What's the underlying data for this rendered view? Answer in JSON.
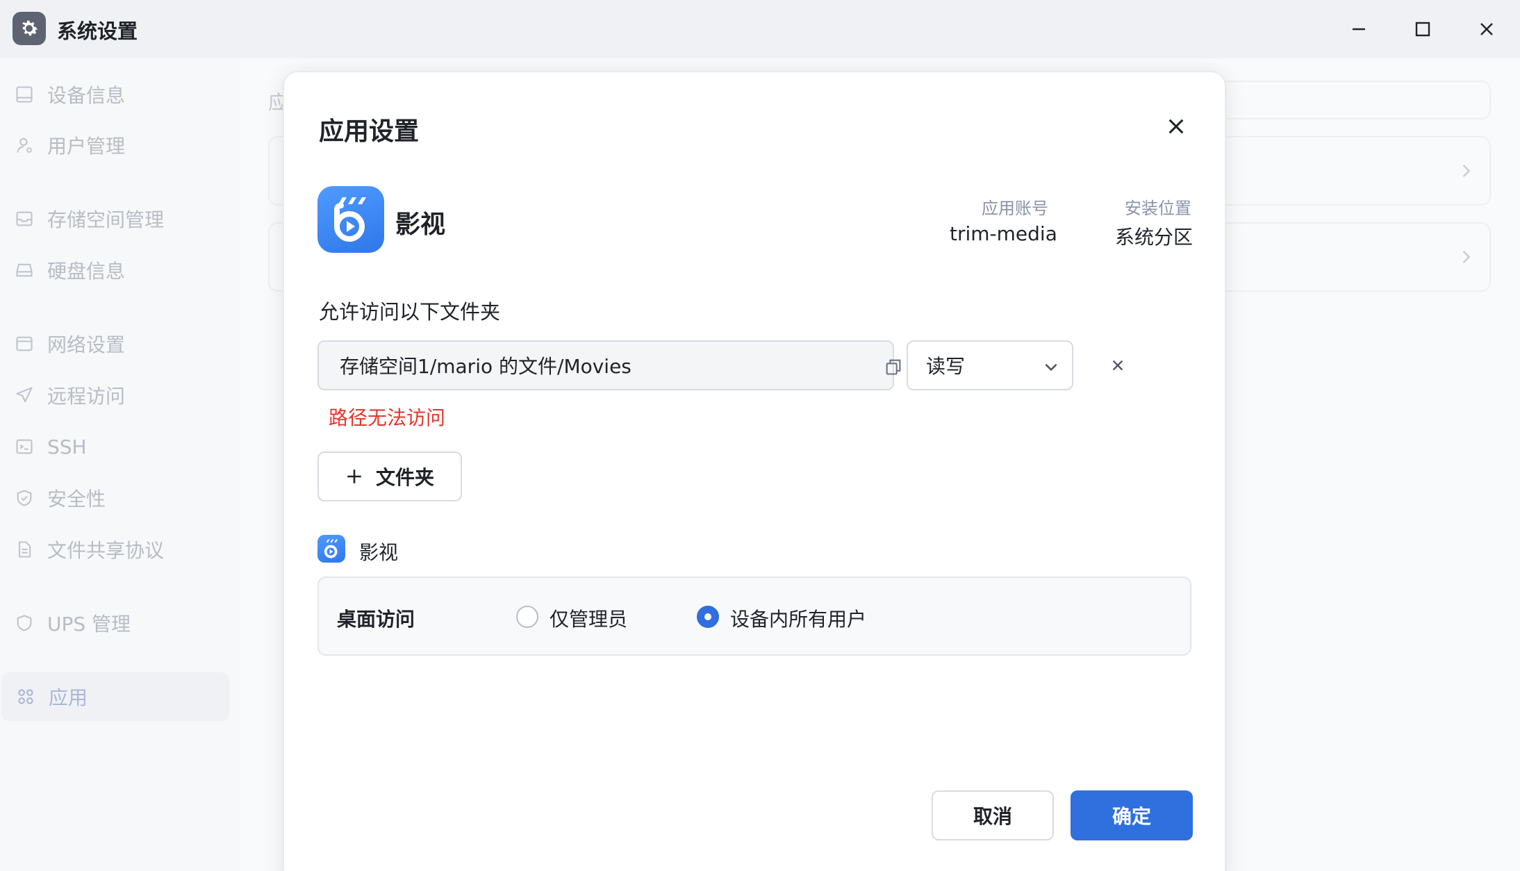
{
  "window": {
    "title": "系统设置",
    "icon": "gear-icon"
  },
  "sidebar": {
    "items": [
      {
        "label": "设备信息",
        "icon": "device-icon"
      },
      {
        "label": "用户管理",
        "icon": "user-icon"
      },
      {
        "label": "存储空间管理",
        "icon": "storage-icon"
      },
      {
        "label": "硬盘信息",
        "icon": "disk-icon"
      },
      {
        "label": "网络设置",
        "icon": "network-icon"
      },
      {
        "label": "远程访问",
        "icon": "send-icon"
      },
      {
        "label": "SSH",
        "icon": "terminal-icon"
      },
      {
        "label": "安全性",
        "icon": "shield-check-icon"
      },
      {
        "label": "文件共享协议",
        "icon": "file-icon"
      },
      {
        "label": "UPS 管理",
        "icon": "shield-icon"
      },
      {
        "label": "应用",
        "icon": "apps-icon",
        "active": true
      }
    ]
  },
  "background": {
    "section_label": "应"
  },
  "dialog": {
    "title": "应用设置",
    "app": {
      "name": "影视",
      "account_label": "应用账号",
      "account_value": "trim-media",
      "location_label": "安装位置",
      "location_value": "系统分区"
    },
    "folders_title": "允许访问以下文件夹",
    "folder_row": {
      "path": "存储空间1/mario 的文件/Movies",
      "permission": "读写",
      "error": "路径无法访问"
    },
    "add_folder_label": "文件夹",
    "sub_app_name": "影视",
    "desktop_access": {
      "label": "桌面访问",
      "options": [
        {
          "label": "仅管理员",
          "checked": false
        },
        {
          "label": "设备内所有用户",
          "checked": true
        }
      ]
    },
    "cancel_label": "取消",
    "ok_label": "确定"
  },
  "colors": {
    "accent": "#2f6fde",
    "error": "#e5352b",
    "app_gradient_start": "#4f9bff",
    "app_gradient_end": "#2f77ea"
  }
}
